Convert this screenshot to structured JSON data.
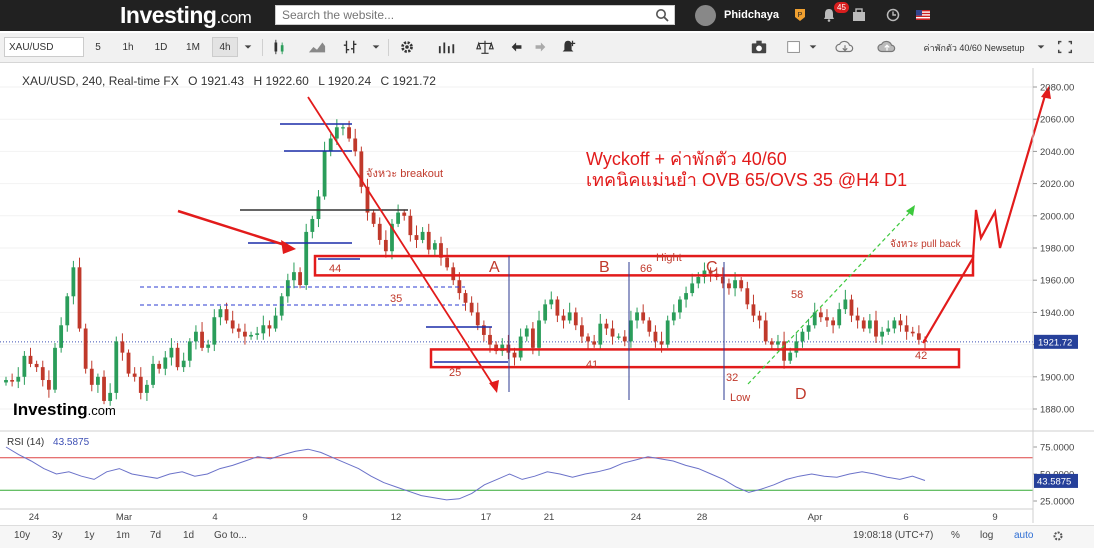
{
  "site": {
    "logo_main": "Investing",
    "logo_suffix": ".com",
    "search_placeholder": "Search the website...",
    "username": "Phidchaya",
    "notification_count": "45"
  },
  "toolbar": {
    "symbol": "XAU/USD",
    "intervals": [
      "5",
      "1h",
      "1D",
      "1M",
      "4h"
    ],
    "active_interval": "4h",
    "layout_name": "ค่าพักตัว 40/60 Newsetup"
  },
  "legend": {
    "title": "XAU/USD, 240, Real-time FX",
    "open": "O 1921.43",
    "high": "H 1922.60",
    "low": "L 1920.24",
    "close": "C 1921.72"
  },
  "rsi": {
    "label": "RSI (14)",
    "value": "43.5875",
    "axis_ticks": [
      "75.0000",
      "50.0000",
      "25.0000"
    ],
    "overbought": 65,
    "oversold": 35
  },
  "watermark": {
    "main": "Investing",
    "suffix": ".com"
  },
  "annotations": {
    "title_line1": "Wyckoff + ค่าพักตัว 40/60",
    "title_line2": "เทคนิคแม่นยำ OVB 65/OVS 35 @H4 D1",
    "breakout_label": "จังหวะ breakout",
    "pullback_label": "จังหวะ pull back",
    "point_a": "A",
    "point_b": "B",
    "point_c": "C",
    "point_d": "D",
    "hight": "Hight",
    "low": "Low",
    "num_44": "44",
    "num_35": "35",
    "num_25": "25",
    "num_41": "41",
    "num_66": "66",
    "num_32": "32",
    "num_58": "58",
    "num_42": "42"
  },
  "chart_data": {
    "type": "candlestick",
    "symbol": "XAU/USD",
    "timeframe": "240",
    "price_axis": {
      "ticks": [
        2080,
        2060,
        2040,
        2020,
        2000,
        1980,
        1960,
        1940,
        1920,
        1900,
        1880
      ],
      "last_price": 1921.72,
      "range": [
        1870,
        2085
      ]
    },
    "time_axis": {
      "labels": [
        "24",
        "Mar",
        "4",
        "9",
        "12",
        "17",
        "21",
        "24",
        "28",
        "Apr",
        "6",
        "9"
      ]
    },
    "resistance_box": [
      1963,
      1975
    ],
    "support_box": [
      1906,
      1917
    ],
    "close_path": [
      1898,
      1897,
      1900,
      1913,
      1908,
      1906,
      1898,
      1892,
      1918,
      1932,
      1950,
      1968,
      1930,
      1905,
      1895,
      1900,
      1885,
      1890,
      1922,
      1915,
      1902,
      1900,
      1890,
      1895,
      1908,
      1905,
      1912,
      1918,
      1906,
      1910,
      1922,
      1928,
      1918,
      1920,
      1937,
      1942,
      1935,
      1930,
      1928,
      1925,
      1926,
      1927,
      1932,
      1930,
      1938,
      1950,
      1960,
      1965,
      1957,
      1990,
      1998,
      2012,
      2040,
      2048,
      2055,
      2055,
      2048,
      2040,
      2018,
      2002,
      1995,
      1985,
      1978,
      1995,
      2002,
      2000,
      1988,
      1985,
      1990,
      1979,
      1983,
      1974,
      1968,
      1960,
      1952,
      1946,
      1940,
      1932,
      1926,
      1920,
      1916,
      1920,
      1915,
      1912,
      1925,
      1930,
      1918,
      1935,
      1945,
      1948,
      1938,
      1935,
      1940,
      1932,
      1925,
      1922,
      1920,
      1933,
      1930,
      1925,
      1925,
      1922,
      1935,
      1940,
      1935,
      1928,
      1922,
      1920,
      1935,
      1940,
      1948,
      1952,
      1958,
      1962,
      1966,
      1964,
      1962,
      1958,
      1955,
      1960,
      1955,
      1945,
      1938,
      1935,
      1922,
      1920,
      1922,
      1910,
      1915,
      1922,
      1928,
      1932,
      1940,
      1937,
      1935,
      1932,
      1942,
      1948,
      1938,
      1935,
      1930,
      1935,
      1925,
      1928,
      1930,
      1935,
      1932,
      1928,
      1927,
      1923,
      1921.72
    ],
    "rsi_path": [
      75,
      68,
      62,
      55,
      50,
      52,
      48,
      45,
      52,
      55,
      50,
      48,
      46,
      50,
      52,
      48,
      50,
      55,
      58,
      62,
      66,
      64,
      68,
      71,
      73,
      70,
      65,
      60,
      55,
      48,
      42,
      38,
      34,
      30,
      28,
      26,
      27,
      32,
      40,
      45,
      50,
      45,
      48,
      52,
      50,
      47,
      50,
      52,
      55,
      60,
      63,
      66,
      64,
      62,
      58,
      55,
      50,
      45,
      38,
      33,
      36,
      40,
      45,
      48,
      50,
      48,
      47,
      50,
      52,
      50,
      47,
      45,
      48,
      44
    ]
  }
}
